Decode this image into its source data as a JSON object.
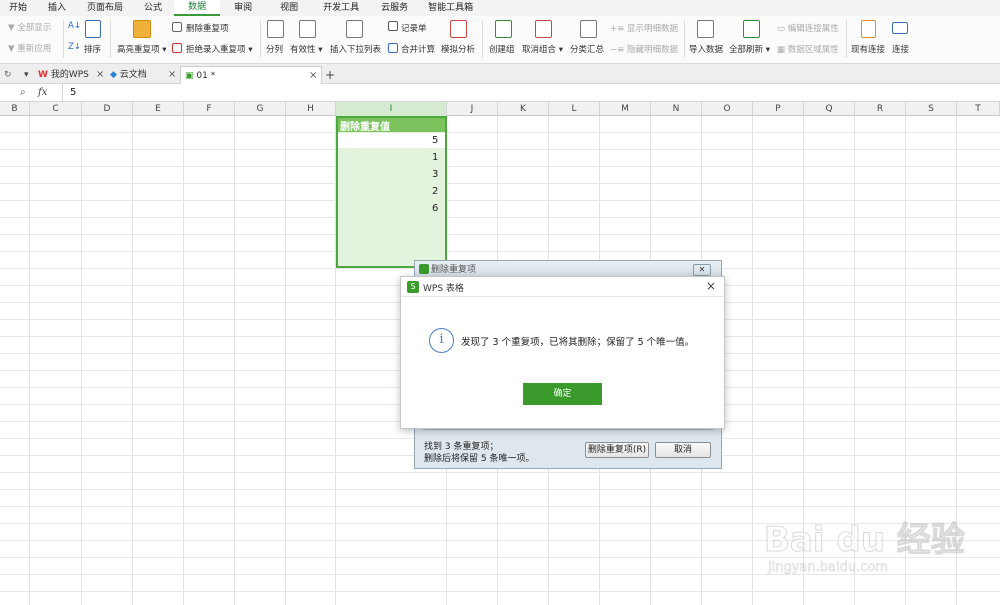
{
  "menu": {
    "tabs": [
      "开始",
      "插入",
      "页面布局",
      "公式",
      "数据",
      "审阅",
      "视图",
      "开发工具",
      "云服务",
      "智能工具箱"
    ],
    "active": "数据"
  },
  "ribbon": {
    "show_all": "全部显示",
    "reapply": "重新应用",
    "sort": "排序",
    "highlight_dup": "高亮重复项",
    "delete_dup": "删除重复项",
    "reject_dup": "拒绝录入重复项",
    "split": "分列",
    "validity": "有效性",
    "dropdown": "插入下拉列表",
    "record": "记录单",
    "merge_calc": "合并计算",
    "simulate": "模拟分析",
    "create_group": "创建组",
    "ungroup": "取消组合",
    "subtotal": "分类汇总",
    "show_detail": "显示明细数据",
    "hide_detail": "隐藏明细数据",
    "import": "导入数据",
    "refresh_all": "全部刷新",
    "edit_link": "编辑连接属性",
    "range_props": "数据区域属性",
    "existing_conn": "现有连接",
    "connect": "连接"
  },
  "doc_tabs": {
    "wps": "我的WPS",
    "cloud": "云文档",
    "file": "01 *"
  },
  "formula_bar": {
    "fx": "fx",
    "value": "5"
  },
  "columns": [
    "B",
    "C",
    "D",
    "E",
    "F",
    "G",
    "H",
    "I",
    "J",
    "K",
    "L",
    "M",
    "N",
    "O",
    "P",
    "Q",
    "R",
    "S",
    "T"
  ],
  "sheet": {
    "header_cell": "删除重复值",
    "values": [
      "5",
      "1",
      "3",
      "2",
      "6"
    ]
  },
  "bg_dialog": {
    "title": "删除重复项",
    "found": "找到 3 条重复项；",
    "keep": "删除后将保留 5 条唯一项。",
    "delete_btn": "删除重复项(R)",
    "cancel_btn": "取消"
  },
  "modal": {
    "title": "WPS 表格",
    "message": "发现了 3 个重复项，已将其删除；保留了 5 个唯一值。",
    "ok": "确定",
    "close": "×"
  },
  "watermark": {
    "brand": "Bai du 经验",
    "url": "jingyan.baidu.com"
  },
  "colors": {
    "accent": "#3a9a2b",
    "selection": "#4aa83f",
    "info": "#4a7fc1"
  }
}
